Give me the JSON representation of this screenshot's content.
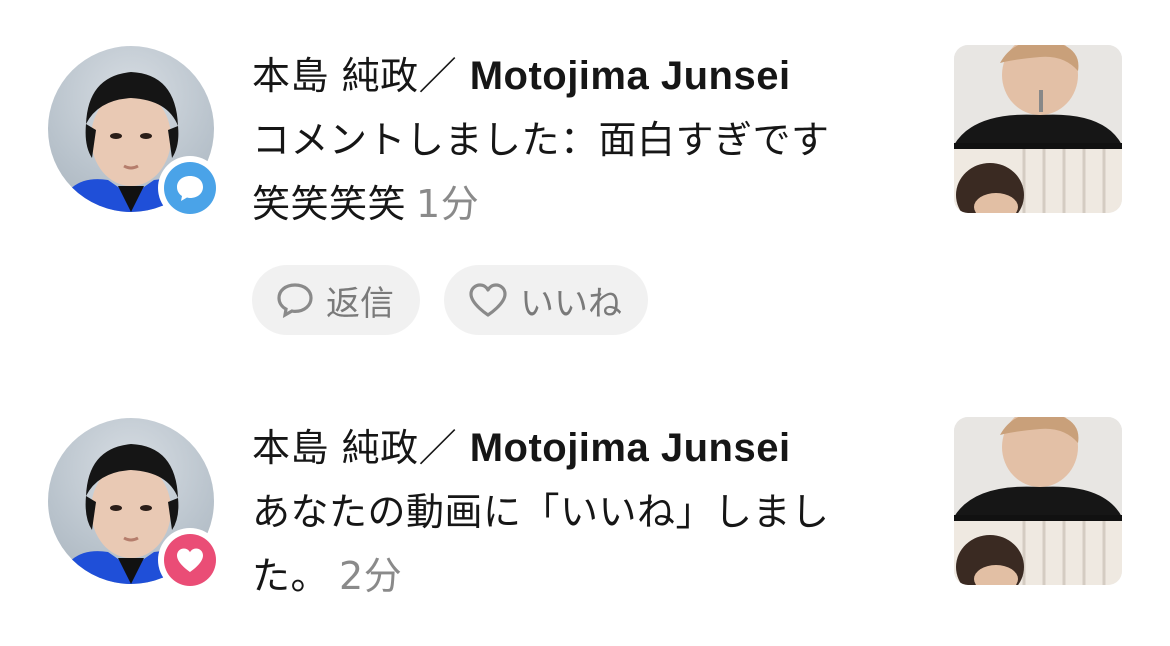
{
  "notifications": [
    {
      "type": "comment",
      "name_jp": "本島 純政／",
      "name_en": "Motojima Junsei",
      "line1": "コメントしました：面白すぎです",
      "line2": "笑笑笑笑",
      "time": "1分",
      "actions": {
        "reply_label": "返信",
        "like_label": "いいね"
      },
      "badge_icon": "comment-bubble-icon",
      "badge_color": "#4aa3e8"
    },
    {
      "type": "like",
      "name_jp": "本島 純政／",
      "name_en": "Motojima Junsei",
      "line1": "あなたの動画に「いいね」しまし",
      "line2": "た。",
      "time": "2分",
      "badge_icon": "heart-icon",
      "badge_color": "#ea4d76"
    }
  ]
}
